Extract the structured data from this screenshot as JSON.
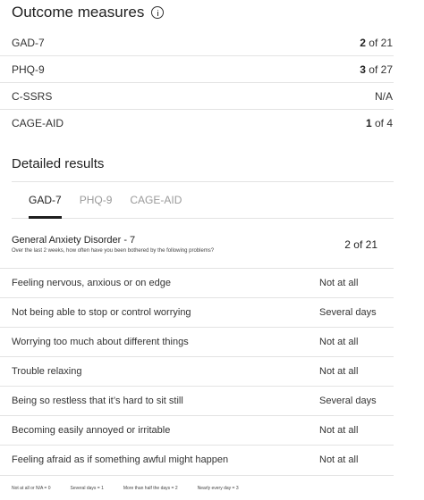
{
  "outcome": {
    "title": "Outcome measures",
    "rows": [
      {
        "name": "GAD-7",
        "score": "2",
        "of": " of 21"
      },
      {
        "name": "PHQ-9",
        "score": "3",
        "of": " of 27"
      },
      {
        "name": "C-SSRS",
        "score": "",
        "of": "N/A"
      },
      {
        "name": "CAGE-AID",
        "score": "1",
        "of": " of 4"
      }
    ]
  },
  "detailed": {
    "title": "Detailed results",
    "tabs": [
      "GAD-7",
      "PHQ-9",
      "CAGE-AID"
    ],
    "active_tab": "GAD-7",
    "header": {
      "name": "General Anxiety Disorder - 7",
      "subtitle": "Over the last 2 weeks, how often have you been bothered by the following problems?",
      "score": "2 of 21"
    },
    "questions": [
      {
        "text": "Feeling nervous, anxious or on edge",
        "answer": "Not at all"
      },
      {
        "text": "Not being able to stop or control worrying",
        "answer": "Several days"
      },
      {
        "text": "Worrying too much about different things",
        "answer": "Not at all"
      },
      {
        "text": "Trouble relaxing",
        "answer": "Not at all"
      },
      {
        "text": "Being so restless that it’s hard to sit still",
        "answer": "Several days"
      },
      {
        "text": "Becoming easily annoyed or irritable",
        "answer": "Not at all"
      },
      {
        "text": "Feeling afraid as if something awful might happen",
        "answer": "Not at all"
      }
    ],
    "legend": [
      "Not at all or N/A = 0",
      "Several days = 1",
      "More than half the days = 2",
      "Nearly every day = 3"
    ]
  },
  "icons": {
    "info": "info-circle-icon"
  }
}
